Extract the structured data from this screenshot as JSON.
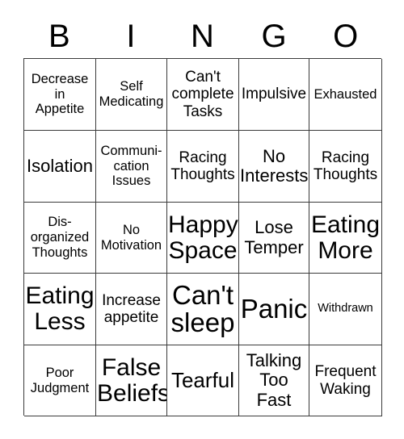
{
  "card": {
    "title": "BINGO",
    "header_letters": [
      "B",
      "I",
      "N",
      "G",
      "O"
    ],
    "colors": {
      "background": "#ffffff",
      "text": "#000000",
      "grid_line": "#3a3a3a"
    },
    "grid": {
      "columns": 5,
      "rows": 5
    },
    "cells": [
      {
        "text": "Decrease\nin\nAppetite",
        "size": "sm",
        "column": "B",
        "row": 1
      },
      {
        "text": "Self\nMedicating",
        "size": "sm",
        "column": "I",
        "row": 1
      },
      {
        "text": "Can't\ncomplete\nTasks",
        "size": "md",
        "column": "N",
        "row": 1
      },
      {
        "text": "Impulsive",
        "size": "md",
        "column": "G",
        "row": 1
      },
      {
        "text": "Exhausted",
        "size": "sm",
        "column": "O",
        "row": 1
      },
      {
        "text": "Isolation",
        "size": "lg",
        "column": "B",
        "row": 2
      },
      {
        "text": "Communi-\ncation\nIssues",
        "size": "sm",
        "column": "I",
        "row": 2
      },
      {
        "text": "Racing\nThoughts",
        "size": "md",
        "column": "N",
        "row": 2
      },
      {
        "text": "No\nInterests",
        "size": "lg",
        "column": "G",
        "row": 2
      },
      {
        "text": "Racing\nThoughts",
        "size": "md",
        "column": "O",
        "row": 2
      },
      {
        "text": "Dis-\norganized\nThoughts",
        "size": "sm",
        "column": "B",
        "row": 3
      },
      {
        "text": "No\nMotivation",
        "size": "sm",
        "column": "I",
        "row": 3
      },
      {
        "text": "Happy\nSpace",
        "size": "xxl",
        "column": "N",
        "row": 3
      },
      {
        "text": "Lose\nTemper",
        "size": "lg",
        "column": "G",
        "row": 3
      },
      {
        "text": "Eating\nMore",
        "size": "xxl",
        "column": "O",
        "row": 3
      },
      {
        "text": "Eating\nLess",
        "size": "xxl",
        "column": "B",
        "row": 4
      },
      {
        "text": "Increase\nappetite",
        "size": "md",
        "column": "I",
        "row": 4
      },
      {
        "text": "Can't\nsleep",
        "size": "xxxl",
        "column": "N",
        "row": 4
      },
      {
        "text": "Panic",
        "size": "xxxl",
        "column": "G",
        "row": 4
      },
      {
        "text": "Withdrawn",
        "size": "xs",
        "column": "O",
        "row": 4
      },
      {
        "text": "Poor\nJudgment",
        "size": "sm",
        "column": "B",
        "row": 5
      },
      {
        "text": "False\nBeliefs",
        "size": "xxl",
        "column": "I",
        "row": 5
      },
      {
        "text": "Tearful",
        "size": "xl",
        "column": "N",
        "row": 5
      },
      {
        "text": "Talking\nToo\nFast",
        "size": "lg",
        "column": "G",
        "row": 5
      },
      {
        "text": "Frequent\nWaking",
        "size": "md",
        "column": "O",
        "row": 5
      }
    ]
  }
}
